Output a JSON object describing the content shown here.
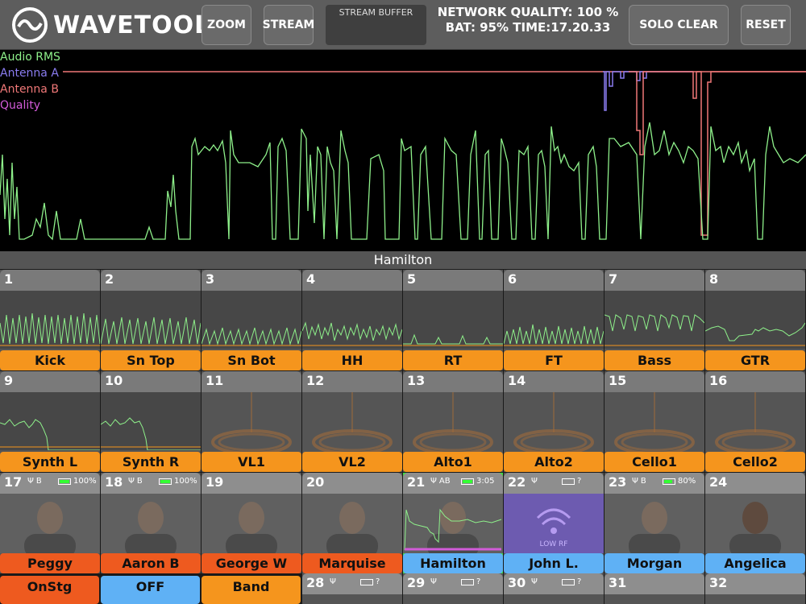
{
  "app": {
    "title": "WAVETOOL"
  },
  "toolbar": {
    "zoom": "ZOOM",
    "stream": "STREAM",
    "buffer_label": "STREAM BUFFER",
    "network": "NETWORK QUALITY: 100 %",
    "battime": "BAT: 95% TIME:17.20.33",
    "solo_clear": "SOLO CLEAR",
    "reset": "RESET"
  },
  "legend": {
    "rms": "Audio RMS",
    "a": "Antenna A",
    "b": "Antenna B",
    "q": "Quality"
  },
  "colors": {
    "rms": "#8ef08a",
    "a": "#8a7cf0",
    "b": "#f07878",
    "q": "#d25bd8",
    "orange": "#f5951d",
    "blue": "#5fb1f5",
    "red": "#ee5a1f",
    "selected": "#3ee03e"
  },
  "selected": "Hamilton",
  "channels": [
    {
      "n": "1",
      "name": "Kick"
    },
    {
      "n": "2",
      "name": "Sn Top"
    },
    {
      "n": "3",
      "name": "Sn Bot"
    },
    {
      "n": "4",
      "name": "HH"
    },
    {
      "n": "5",
      "name": "RT"
    },
    {
      "n": "6",
      "name": "FT"
    },
    {
      "n": "7",
      "name": "Bass"
    },
    {
      "n": "8",
      "name": "GTR"
    },
    {
      "n": "9",
      "name": "Synth L"
    },
    {
      "n": "10",
      "name": "Synth R"
    },
    {
      "n": "11",
      "name": "VL1"
    },
    {
      "n": "12",
      "name": "VL2"
    },
    {
      "n": "13",
      "name": "Alto1"
    },
    {
      "n": "14",
      "name": "Alto2"
    },
    {
      "n": "15",
      "name": "Cello1"
    },
    {
      "n": "16",
      "name": "Cello2"
    },
    {
      "n": "17",
      "name": "Peggy",
      "ant": "B",
      "bat": "100%"
    },
    {
      "n": "18",
      "name": "Aaron B",
      "ant": "B",
      "bat": "100%"
    },
    {
      "n": "19",
      "name": "George W"
    },
    {
      "n": "20",
      "name": "Marquise"
    },
    {
      "n": "21",
      "name": "Hamilton",
      "ant": "AB",
      "bat": "3:05"
    },
    {
      "n": "22",
      "name": "John L.",
      "bat": "?",
      "overlay": "LOW RF"
    },
    {
      "n": "23",
      "name": "Morgan",
      "ant": "B",
      "bat": "80%"
    },
    {
      "n": "24",
      "name": "Angelica"
    },
    {
      "n": "28",
      "bat": "?"
    },
    {
      "n": "29",
      "bat": "?"
    },
    {
      "n": "30",
      "bat": "?"
    },
    {
      "n": "31"
    },
    {
      "n": "32"
    }
  ],
  "bottom_buttons": {
    "onstg": "OnStg",
    "off": "OFF",
    "band": "Band"
  }
}
